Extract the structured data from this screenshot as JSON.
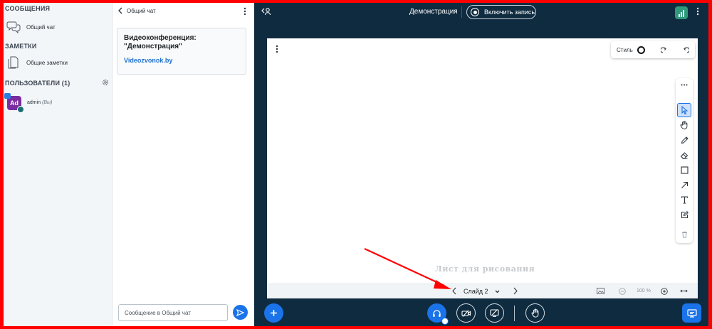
{
  "userlist": {
    "messages_title": "СООБЩЕНИЯ",
    "public_chat": "Общий чат",
    "notes_title": "ЗАМЕТКИ",
    "shared_notes": "Общие заметки",
    "users_title": "ПОЛЬЗОВАТЕЛИ (1)",
    "users": [
      {
        "initials": "Ad",
        "name": "admin",
        "you": "(Вы)",
        "avatar_color": "#7a2da0"
      }
    ]
  },
  "chat": {
    "title": "Общий чат",
    "welcome_text": "Видеоконференция: \"Демонстрация\"",
    "welcome_link": "Videozvonok.by",
    "input_placeholder": "Сообщение в Общий чат"
  },
  "topbar": {
    "meeting_title": "Демонстрация",
    "record_label": "Включить запись"
  },
  "whiteboard": {
    "style_label": "Стиль",
    "watermark": "Лист для рисования",
    "slide_label": "Слайд 2",
    "zoom_label": "100 %",
    "tools": [
      "select-icon",
      "pan-icon",
      "pencil-icon",
      "eraser-icon",
      "rectangle-icon",
      "arrow-icon",
      "text-icon",
      "note-icon",
      "trash-icon"
    ]
  },
  "colors": {
    "accent": "#1a73e8",
    "background": "#0f2b40",
    "frame": "#ff0000"
  }
}
